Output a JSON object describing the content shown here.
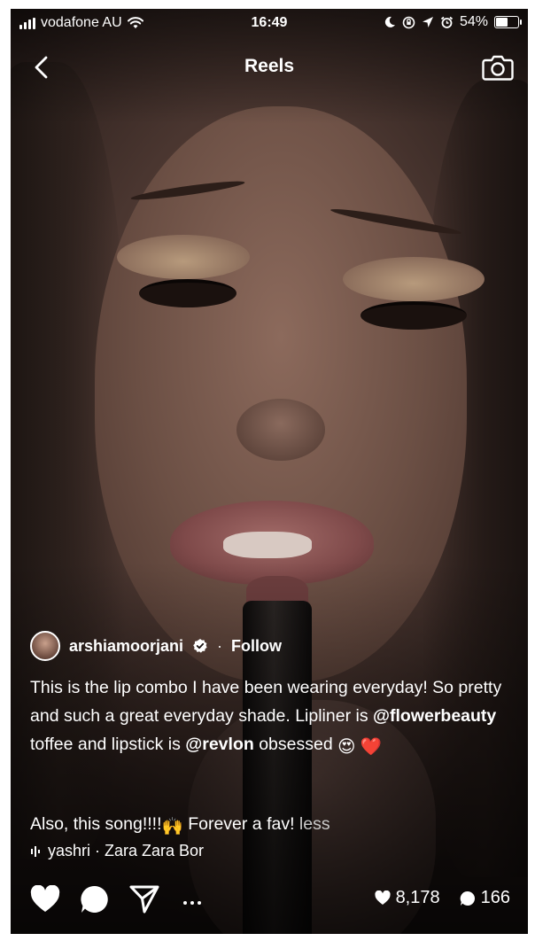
{
  "status_bar": {
    "carrier": "vodafone AU",
    "time": "16:49",
    "battery_percent": "54%",
    "battery_level": 0.54
  },
  "header": {
    "title": "Reels",
    "back_icon": "chevron-left-icon",
    "camera_icon": "camera-icon"
  },
  "post": {
    "username": "arshiamoorjani",
    "separator": "·",
    "follow_label": "Follow",
    "caption": {
      "part1": "This is the lip combo I have been wearing everyday! So pretty and such a great everyday shade. Lipliner is ",
      "mention1": "@flowerbeauty",
      "part2": " toffee and lipstick is ",
      "mention2": "@revlon",
      "part3": " obsessed ",
      "emoji1": "😍",
      "emoji2": "❤️",
      "line2": "Also, this song!!!!",
      "emoji3": "🙌",
      "line2_end": " Forever a fav! ",
      "less_label": "less"
    },
    "audio": "yashri · Zara Zara  Bor"
  },
  "stats": {
    "likes": "8,178",
    "comments": "166"
  },
  "colors": {
    "text": "#ffffff",
    "less": "#c9c9c9"
  }
}
